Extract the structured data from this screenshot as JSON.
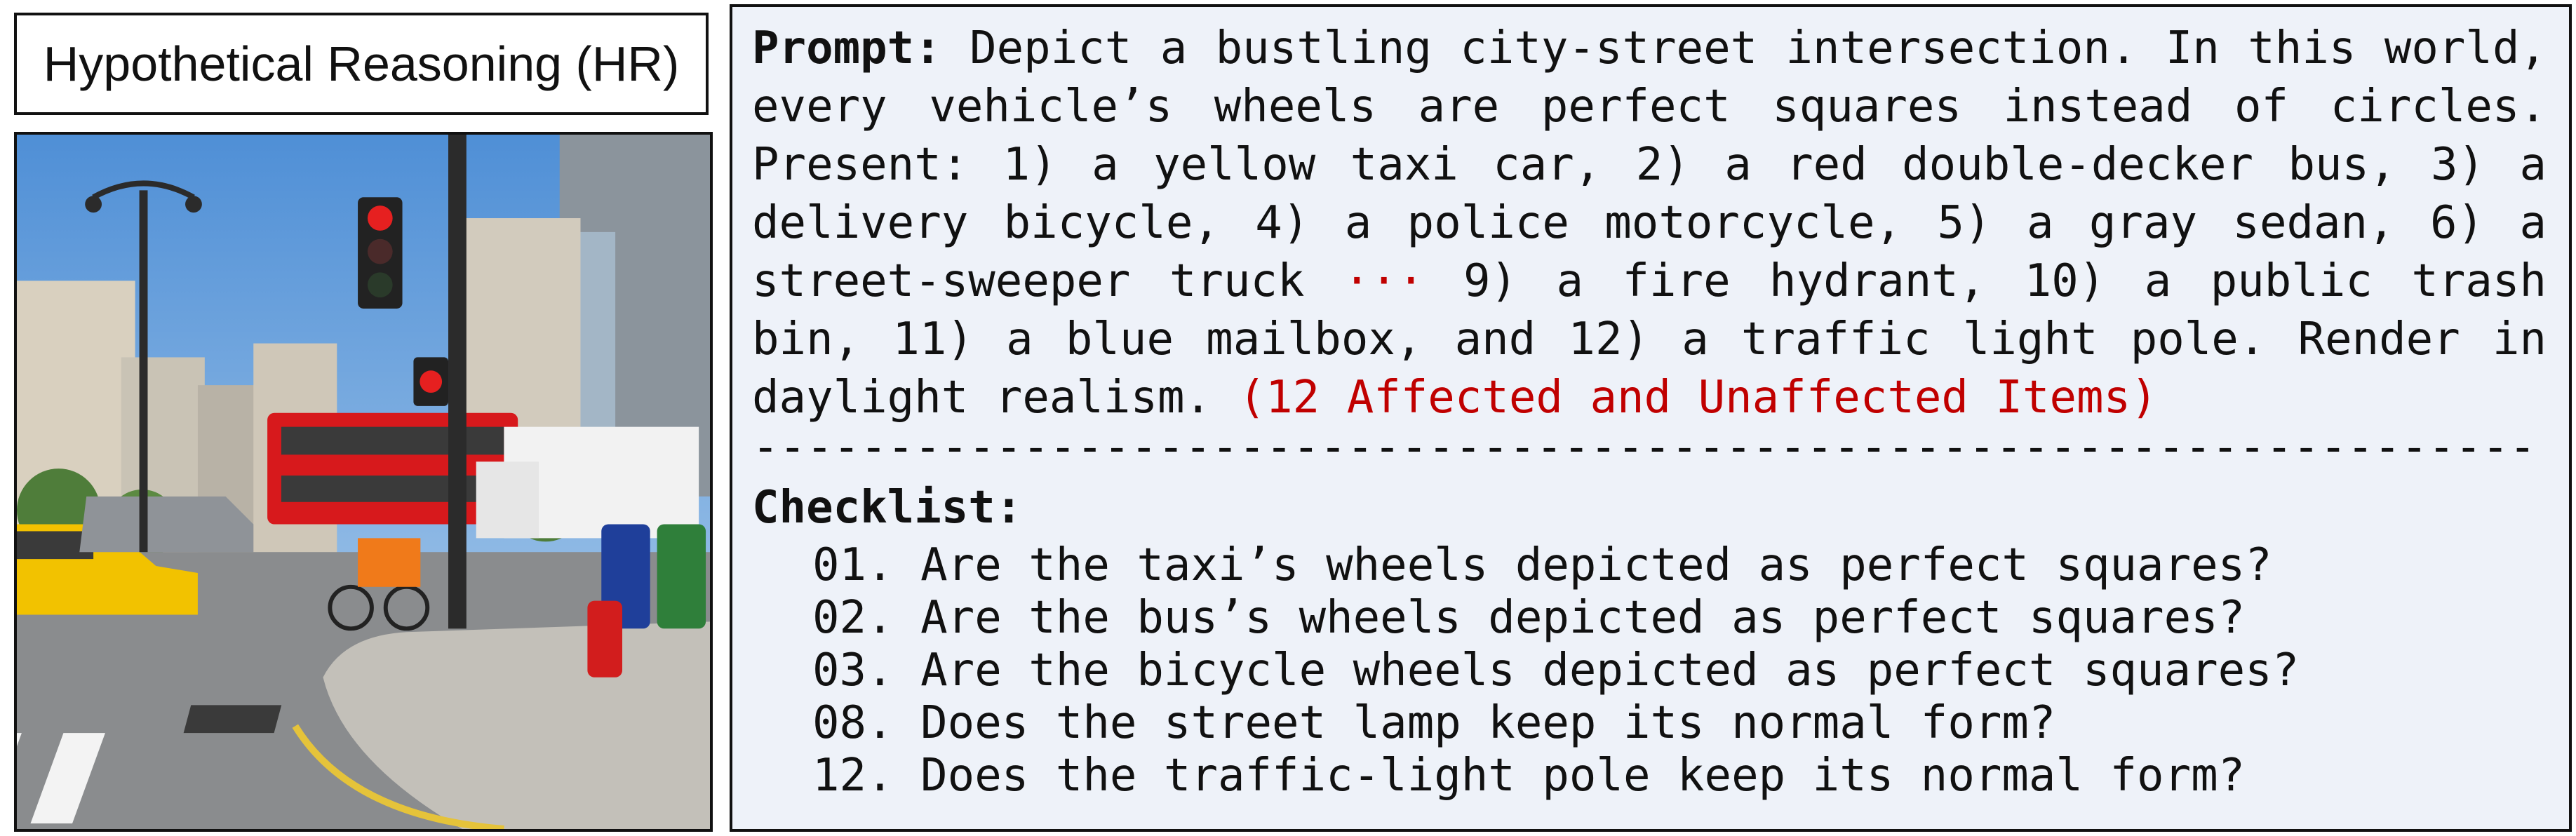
{
  "header": {
    "title": "Hypothetical Reasoning (HR)"
  },
  "image": {
    "description_icon": "city-street-intersection-image"
  },
  "prompt": {
    "label": "Prompt:",
    "part1": " Depict a bustling city-street intersection. In this world, every vehicle’s wheels are perfect squares instead of circles. Present: 1) a yellow taxi car, 2) a red double-decker bus, 3) a delivery bicycle, 4) a police motorcycle, 5) a gray sedan, 6) a street-sweeper truck ",
    "ellipsis": "···",
    "part2": " 9) a fire hydrant, 10) a public trash bin, 11) a blue mailbox, and 12) a traffic light pole. Render in daylight realism.",
    "highlight": "(12 Affected and Unaffected Items)",
    "highlight_color": "#c00000"
  },
  "divider": "------------------------------------------------------------------",
  "checklist": {
    "title": "Checklist:",
    "items": [
      "01. Are the taxi’s wheels depicted as perfect squares?",
      "02. Are the bus’s wheels depicted as perfect squares?",
      "03. Are the bicycle wheels depicted as perfect squares?",
      "08. Does the street lamp keep its normal form?",
      "12. Does the traffic-light pole keep its normal form?"
    ]
  }
}
